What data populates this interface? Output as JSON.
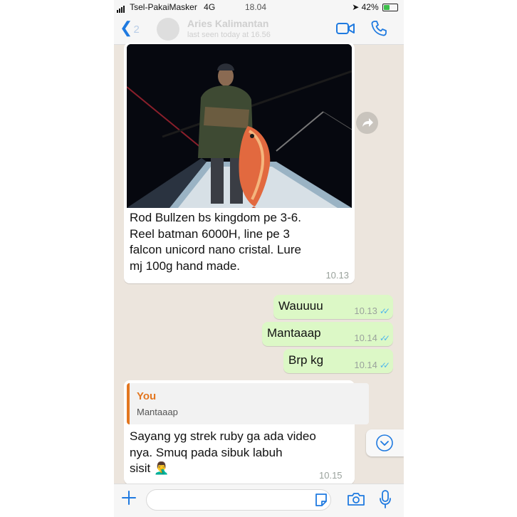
{
  "status_bar": {
    "carrier": "Tsel-PakaiMasker",
    "network": "4G",
    "time": "18.04",
    "battery_percent": "42%"
  },
  "header": {
    "back_count": "2",
    "contact_name": "Aries Kalimantan",
    "last_seen": "last seen today at 16.56",
    "icons": [
      "back-chevron-icon",
      "video-call-icon",
      "phone-call-icon"
    ]
  },
  "messages": [
    {
      "direction": "incoming",
      "has_photo": true,
      "lines": [
        "Rod Bullzen bs kingdom pe 3-6.",
        "Reel batman 6000H, line pe 3",
        "falcon unicord nano cristal. Lure",
        "mj 100g hand made."
      ],
      "time": "10.13"
    },
    {
      "direction": "outgoing",
      "text": "Wauuuu",
      "time": "10.13",
      "read": true
    },
    {
      "direction": "outgoing",
      "text": "Mantaaap",
      "time": "10.14",
      "read": true
    },
    {
      "direction": "outgoing",
      "text": "Brp kg",
      "time": "10.14",
      "read": true
    },
    {
      "direction": "incoming",
      "reply_to": {
        "author": "You",
        "text": "Mantaaap"
      },
      "lines": [
        "Sayang yg strek ruby ga ada video",
        "nya. Smuq pada sibuk labuh",
        "sisit 🤦‍♂️"
      ],
      "time": "10.15"
    }
  ],
  "input": {
    "placeholder": "",
    "value": ""
  },
  "colors": {
    "chat_background": "#ece5dd",
    "outgoing_bubble": "#dcf8c6",
    "incoming_bubble": "#ffffff",
    "accent_blue": "#1f7ae0",
    "read_ticks": "#4fb6ec",
    "reply_accent": "#e3761f"
  }
}
